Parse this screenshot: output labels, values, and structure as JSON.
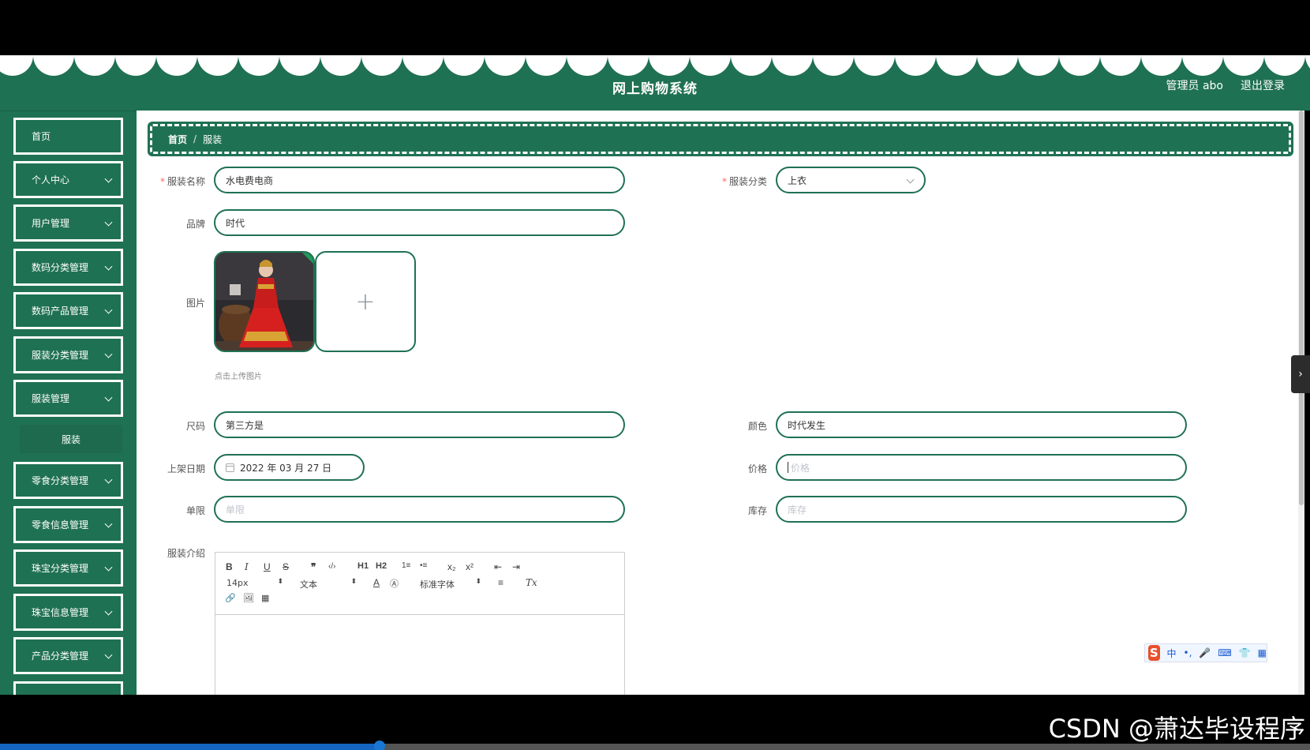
{
  "header": {
    "title": "网上购物系统",
    "user": "管理员 abo",
    "logout": "退出登录"
  },
  "sidebar": {
    "items": [
      {
        "label": "首页",
        "expandable": false
      },
      {
        "label": "个人中心",
        "expandable": true
      },
      {
        "label": "用户管理",
        "expandable": true
      },
      {
        "label": "数码分类管理",
        "expandable": true
      },
      {
        "label": "数码产品管理",
        "expandable": true
      },
      {
        "label": "服装分类管理",
        "expandable": true
      },
      {
        "label": "服装管理",
        "expandable": true
      },
      {
        "label": "零食分类管理",
        "expandable": true
      },
      {
        "label": "零食信息管理",
        "expandable": true
      },
      {
        "label": "珠宝分类管理",
        "expandable": true
      },
      {
        "label": "珠宝信息管理",
        "expandable": true
      },
      {
        "label": "产品分类管理",
        "expandable": true
      }
    ],
    "sub_item": "服装"
  },
  "breadcrumb": {
    "home": "首页",
    "sep": "/",
    "current": "服装"
  },
  "form": {
    "name_label": "服装名称",
    "name_value": "水电费电商",
    "category_label": "服装分类",
    "category_value": "上衣",
    "brand_label": "品牌",
    "brand_value": "时代",
    "image_label": "图片",
    "upload_hint": "点击上传图片",
    "upload_plus": "+",
    "size_label": "尺码",
    "size_value": "第三方是",
    "color_label": "颜色",
    "color_value": "时代发生",
    "date_label": "上架日期",
    "date_value": "2022 年 03 月 27 日",
    "price_label": "价格",
    "price_placeholder": "价格",
    "limit_label": "单限",
    "limit_placeholder": "单限",
    "stock_label": "库存",
    "stock_placeholder": "库存",
    "intro_label": "服装介绍"
  },
  "editor": {
    "font_size": "14px",
    "updown": "⬍",
    "text_style": "文本",
    "font_family": "标准字体",
    "tools": [
      "B",
      "I",
      "U",
      "S",
      "❞",
      "‹/›",
      "H1",
      "H2",
      "1≡",
      "•≡",
      "x₂",
      "x²",
      "⇤",
      "⇥",
      "A",
      "Ⓐ",
      "≡",
      "Tx",
      "🔗",
      "🖼",
      "▦"
    ]
  },
  "ime": {
    "logo": "S",
    "lang": "中",
    "icons": [
      "•,",
      "🎤",
      "⌨",
      "👕",
      "▦"
    ]
  },
  "watermark": "CSDN @萧达毕设程序",
  "video": {
    "progress_percent": 29
  },
  "side_handle": "›",
  "colors": {
    "primary": "#1f7153",
    "required": "#f56c6c"
  }
}
